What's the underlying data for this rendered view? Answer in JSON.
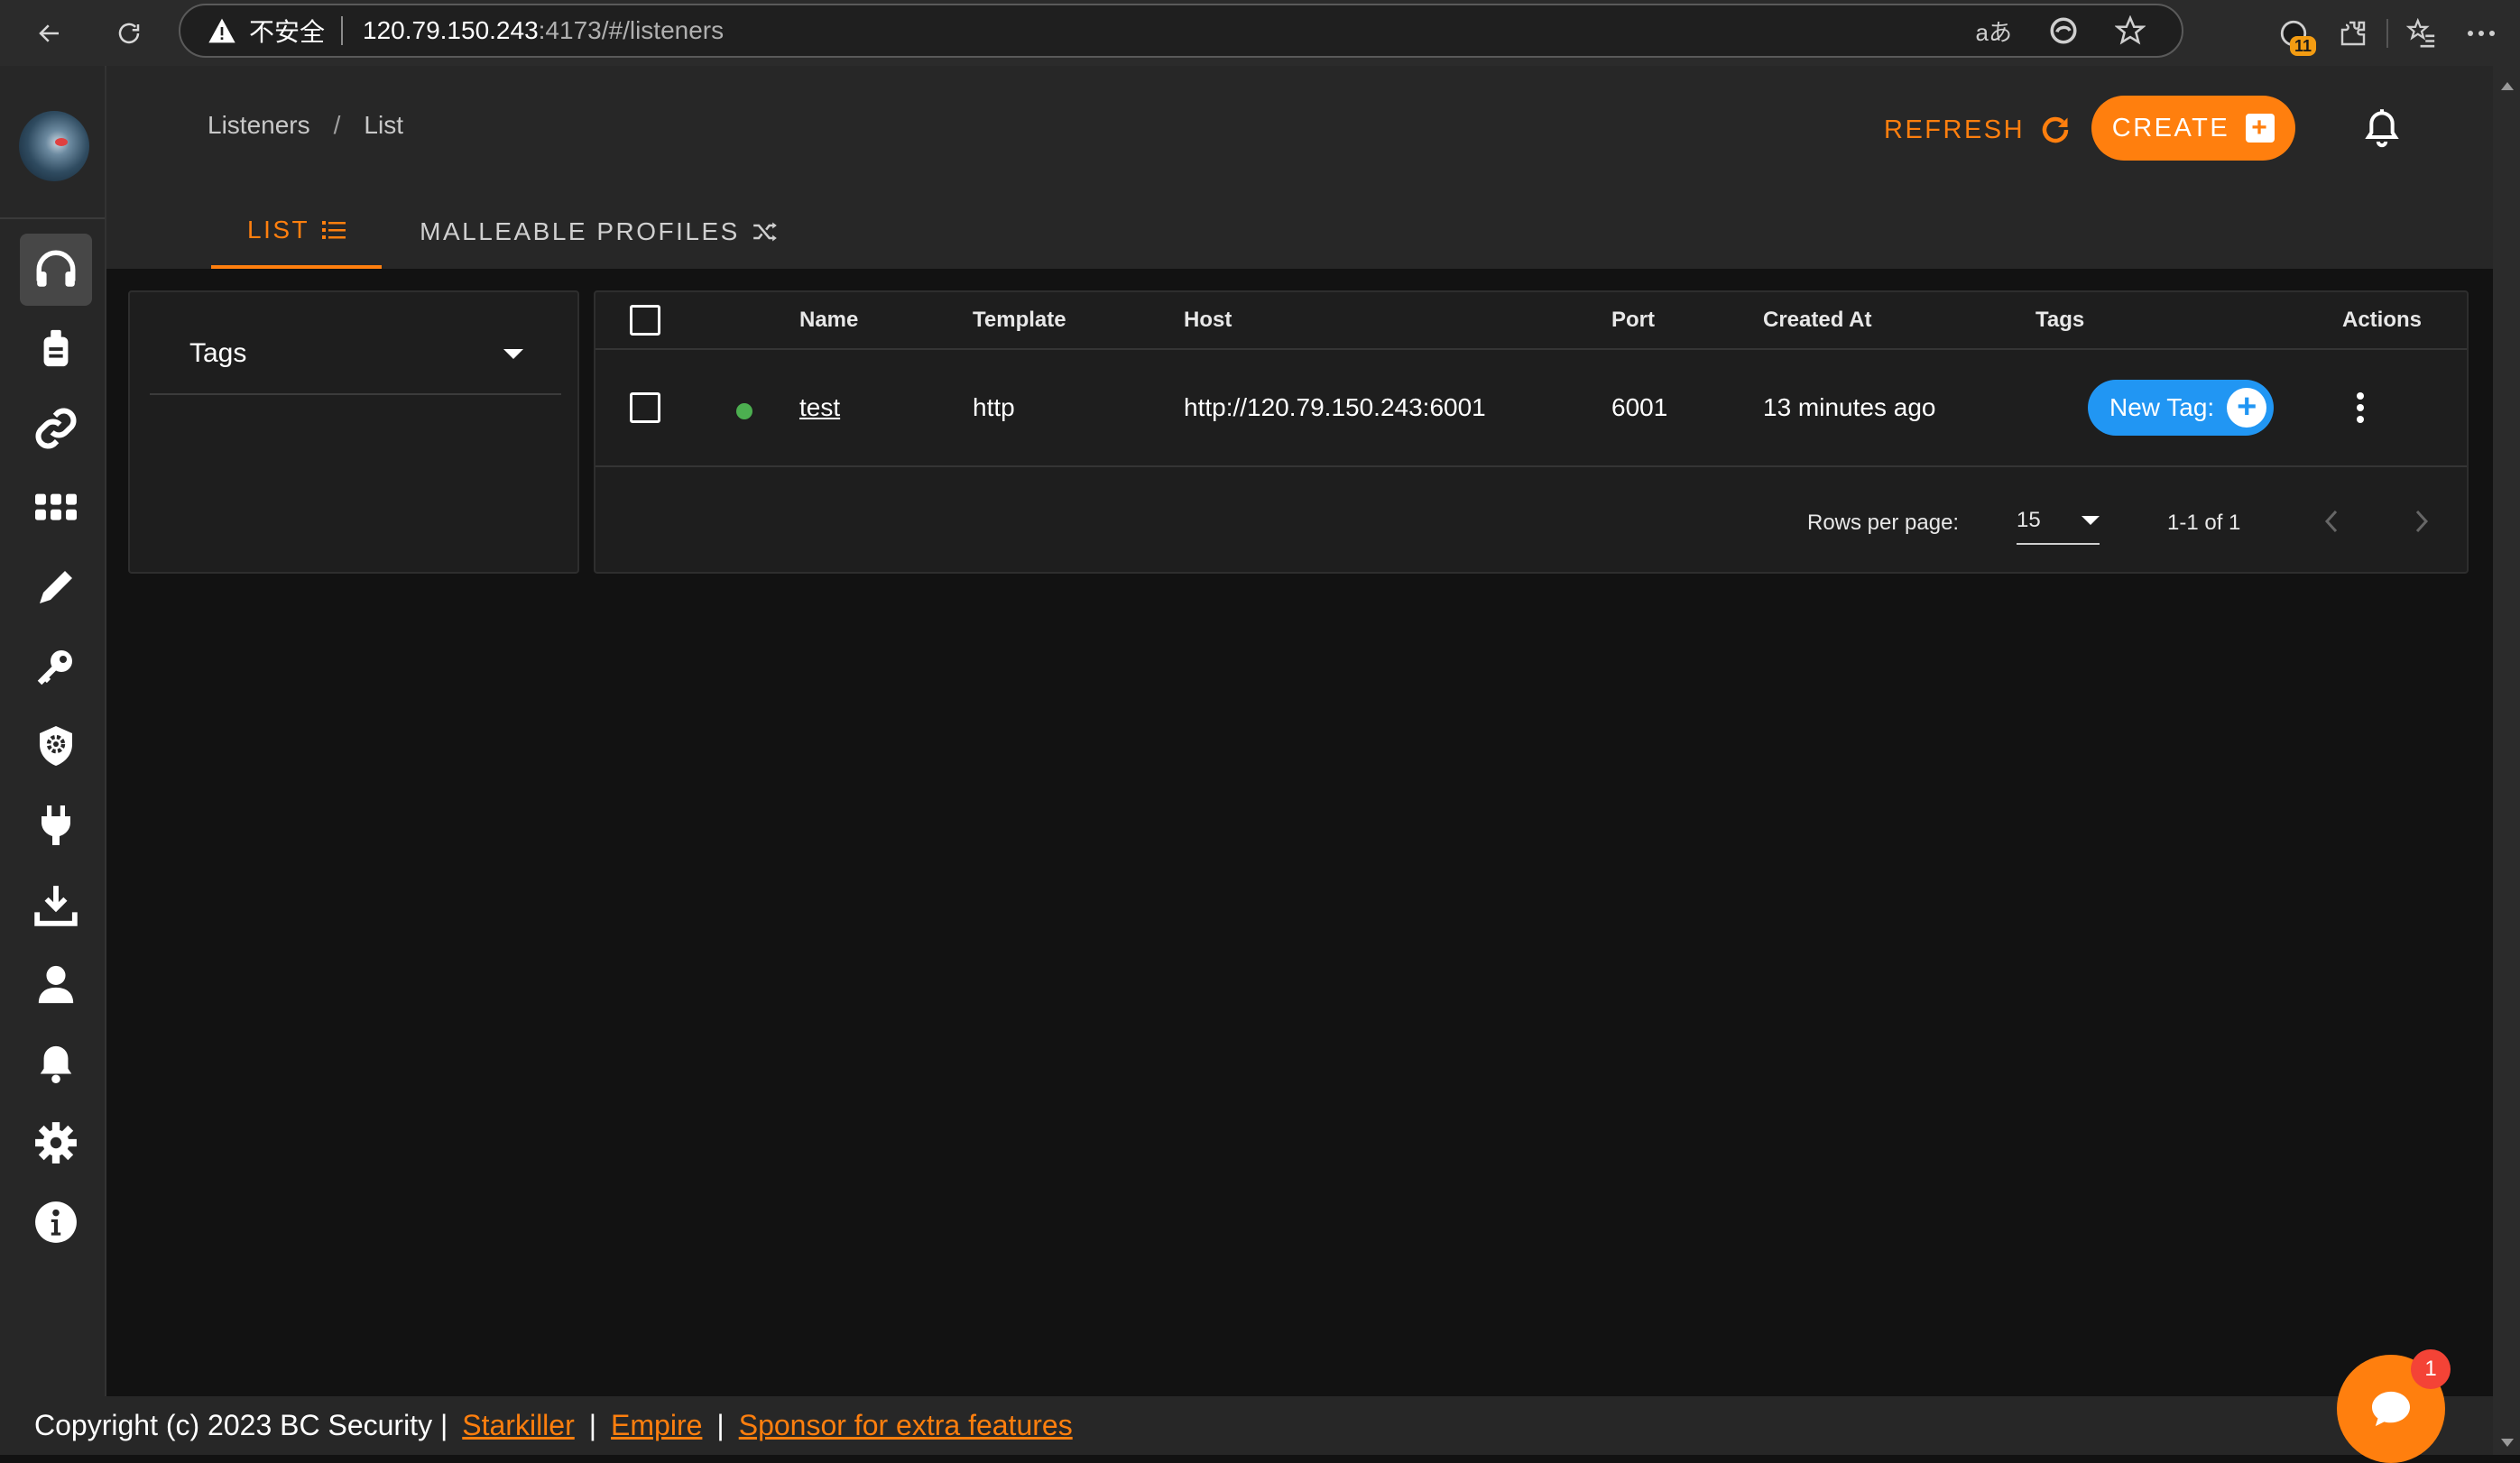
{
  "browser": {
    "insecure_label": "不安全",
    "url_host": "120.79.150.243",
    "url_path": ":4173/#/listeners",
    "extension_badge": "11"
  },
  "breadcrumb": [
    "Listeners",
    "/",
    "List"
  ],
  "header": {
    "refresh_label": "REFRESH",
    "create_label": "CREATE",
    "create_plus": "+"
  },
  "tabs": [
    {
      "label": "LIST",
      "active": true
    },
    {
      "label": "MALLEABLE PROFILES",
      "active": false
    }
  ],
  "sidebar": {
    "items": [
      {
        "icon": "headphones-icon",
        "active": true
      },
      {
        "icon": "agent-icon"
      },
      {
        "icon": "link-icon"
      },
      {
        "icon": "grid-icon"
      },
      {
        "icon": "pen-icon"
      },
      {
        "icon": "key-icon"
      },
      {
        "icon": "shield-gear-icon"
      },
      {
        "icon": "plug-icon"
      },
      {
        "icon": "download-icon"
      },
      {
        "icon": "user-icon"
      },
      {
        "icon": "bell-icon"
      },
      {
        "icon": "settings-icon"
      },
      {
        "icon": "info-icon"
      }
    ]
  },
  "tags_filter": {
    "label": "Tags"
  },
  "table": {
    "columns": [
      "Name",
      "Template",
      "Host",
      "Port",
      "Created At",
      "Tags",
      "Actions"
    ],
    "rows": [
      {
        "status": "active",
        "name": "test",
        "template": "http",
        "host": "http://120.79.150.243:6001",
        "port": "6001",
        "created_at": "13 minutes ago",
        "tag_chip": "New Tag:",
        "tag_chip_plus": "+"
      }
    ],
    "footer": {
      "rows_per_page_label": "Rows per page:",
      "rows_per_page_value": "15",
      "range_text": "1-1 of 1"
    }
  },
  "footer": {
    "copyright": "Copyright (c) 2023 BC Security |",
    "sep": "|",
    "links": [
      "Starkiller",
      "Empire",
      "Sponsor for extra features"
    ]
  },
  "chat": {
    "badge_count": "1"
  },
  "colors": {
    "accent": "#ff7f0e",
    "chip": "#2196f3",
    "status_ok": "#4caf50",
    "badge": "#f44336"
  }
}
